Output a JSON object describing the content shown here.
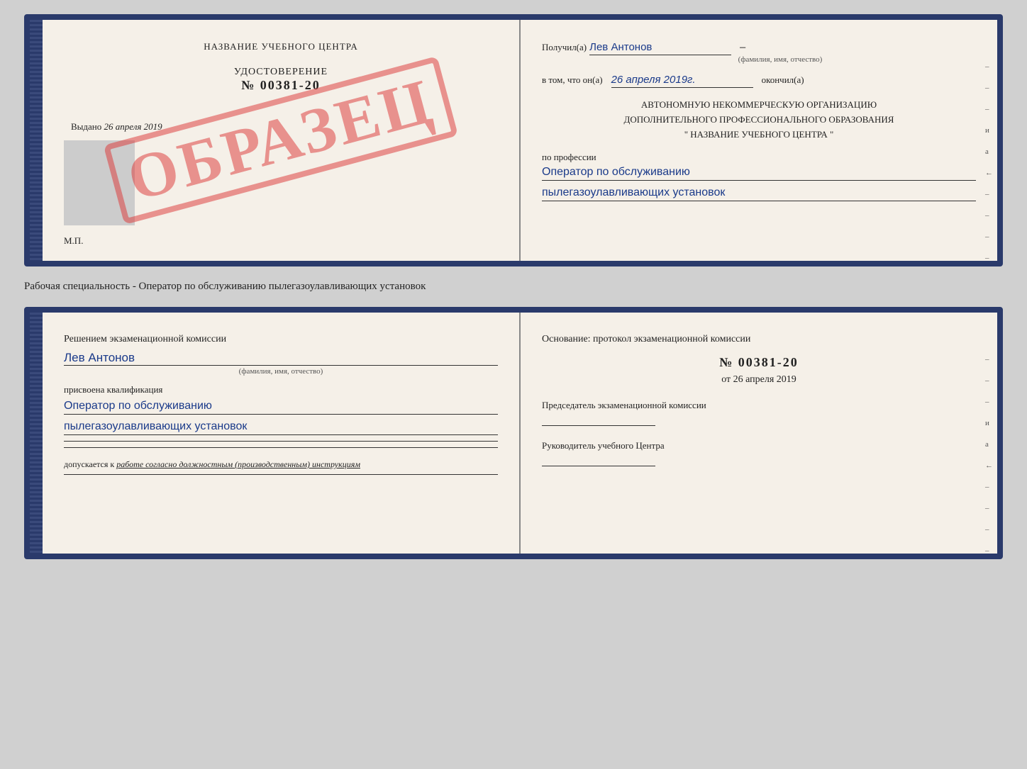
{
  "page": {
    "subtitle": "Рабочая специальность - Оператор по обслуживанию пылегазоулавливающих установок"
  },
  "top_booklet": {
    "left": {
      "header": "НАЗВАНИЕ УЧЕБНОГО ЦЕНТРА",
      "stamp": "ОБРАЗЕЦ",
      "cert_title": "УДОСТОВЕРЕНИЕ",
      "cert_number": "№ 00381-20",
      "issued_label": "Выдано",
      "issued_date": "26 апреля 2019",
      "mp_label": "М.П."
    },
    "right": {
      "received_label": "Получил(а)",
      "received_name": "Лев Антонов",
      "received_subtext": "(фамилия, имя, отчество)",
      "completed_prefix": "в том, что он(а)",
      "completed_date": "26 апреля 2019г.",
      "completed_suffix": "окончил(а)",
      "org_line1": "АВТОНОМНУЮ НЕКОММЕРЧЕСКУЮ ОРГАНИЗАЦИЮ",
      "org_line2": "ДОПОЛНИТЕЛЬНОГО ПРОФЕССИОНАЛЬНОГО ОБРАЗОВАНИЯ",
      "org_line3": "\"   НАЗВАНИЕ УЧЕБНОГО ЦЕНТРА   \"",
      "profession_label": "по профессии",
      "profession_line1": "Оператор по обслуживанию",
      "profession_line2": "пылегазоулавливающих установок",
      "side_marks": [
        "–",
        "–",
        "–",
        "и",
        "а",
        "←",
        "–",
        "–",
        "–",
        "–"
      ]
    }
  },
  "bottom_booklet": {
    "left": {
      "decision_text": "Решением экзаменационной комиссии",
      "name": "Лев Антонов",
      "name_subtext": "(фамилия, имя, отчество)",
      "qualification_label": "присвоена квалификация",
      "qualification_line1": "Оператор по обслуживанию",
      "qualification_line2": "пылегазоулавливающих установок",
      "admission_prefix": "допускается к",
      "admission_italic": "работе согласно должностным (производственным) инструкциям"
    },
    "right": {
      "basis_text": "Основание: протокол экзаменационной комиссии",
      "protocol_number": "№  00381-20",
      "protocol_date_prefix": "от",
      "protocol_date": "26 апреля 2019",
      "chairman_label": "Председатель экзаменационной комиссии",
      "director_label": "Руководитель учебного Центра",
      "side_marks": [
        "–",
        "–",
        "–",
        "и",
        "а",
        "←",
        "–",
        "–",
        "–",
        "–"
      ]
    }
  }
}
